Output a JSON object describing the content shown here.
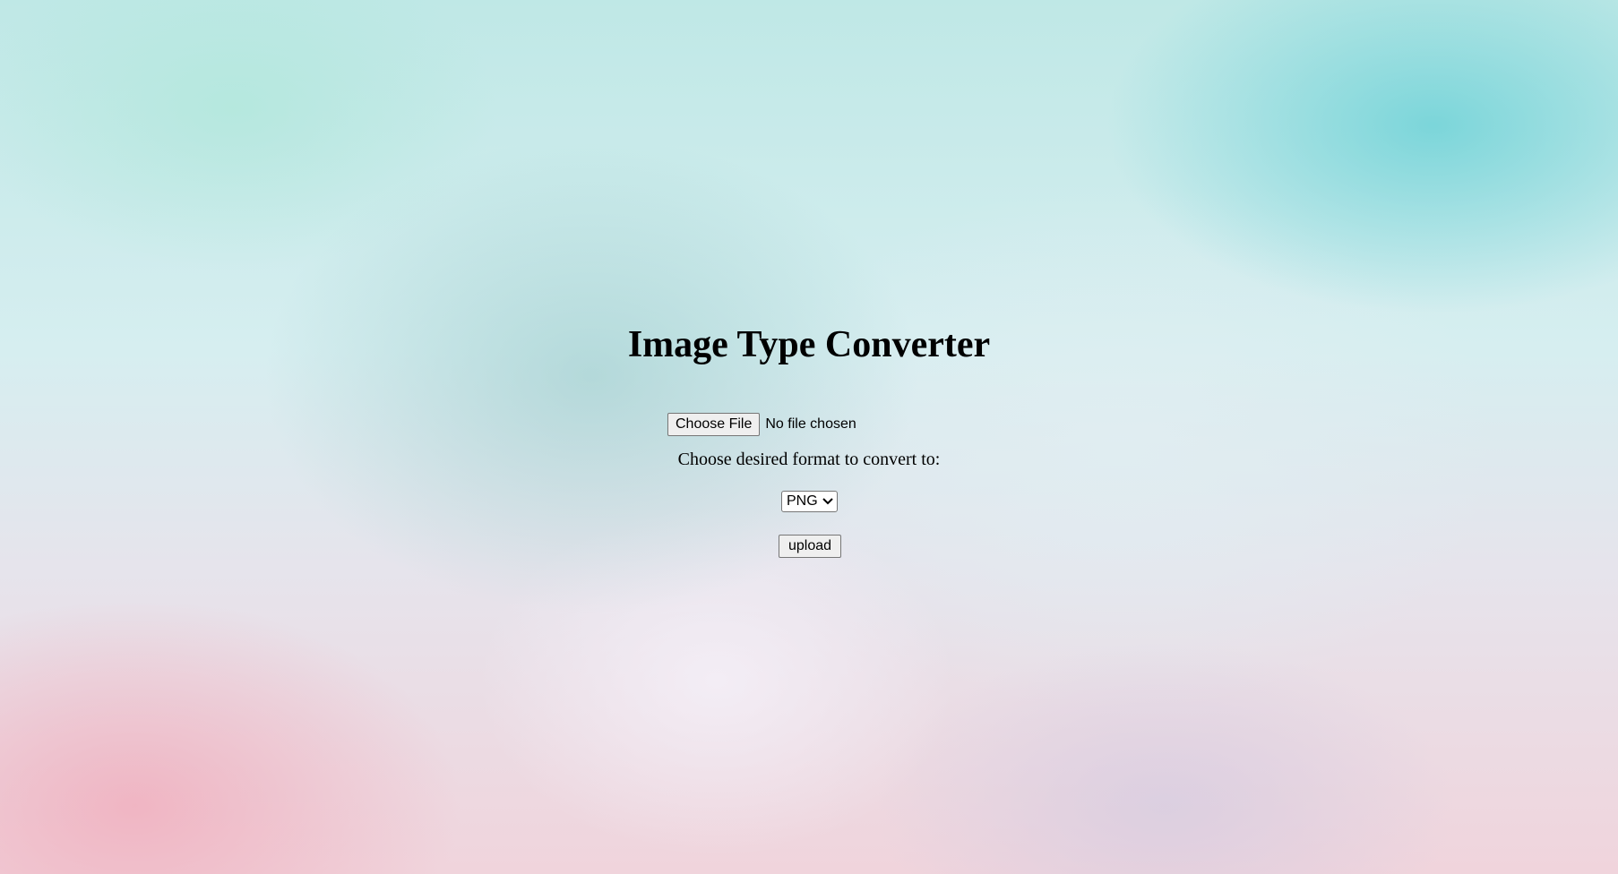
{
  "page": {
    "title": "Image Type Converter"
  },
  "file_input": {
    "button_label": "Choose File",
    "status": "No file chosen"
  },
  "format": {
    "label": "Choose desired format to convert to:",
    "selected": "PNG"
  },
  "upload": {
    "label": "upload"
  },
  "icons": {
    "dropdown": "chevron-down-icon"
  },
  "colors": {
    "text": "#000000",
    "button_bg": "#efefef",
    "button_border": "#767676"
  }
}
